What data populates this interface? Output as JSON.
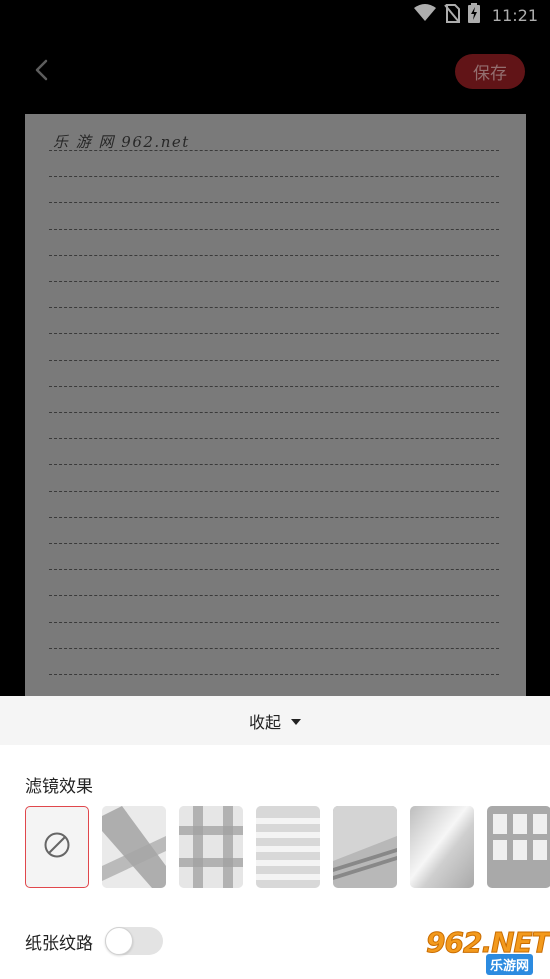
{
  "status_bar": {
    "time": "11:21",
    "icons": [
      "wifi-icon",
      "no-sim-icon",
      "battery-charging-icon"
    ]
  },
  "top_bar": {
    "back_icon": "chevron-left-icon",
    "save_label": "保存",
    "save_color": "#8f1e22"
  },
  "preview": {
    "handwriting": "乐 游 网 962.net"
  },
  "sheet": {
    "collapse_label": "收起",
    "filters_title": "滤镜效果",
    "filters": [
      {
        "name": "none",
        "icon": "ban-icon",
        "selected": true
      },
      {
        "name": "shadow-cross",
        "selected": false
      },
      {
        "name": "shadow-window",
        "selected": false
      },
      {
        "name": "shadow-blinds",
        "selected": false
      },
      {
        "name": "shadow-diagonal",
        "selected": false
      },
      {
        "name": "gradient-light",
        "selected": false
      },
      {
        "name": "shadow-grid",
        "selected": false
      }
    ],
    "paper_texture_label": "纸张纹路",
    "paper_texture_on": false
  },
  "watermark": {
    "main": "962.NET",
    "sub": "乐游网"
  },
  "colors": {
    "accent": "#e0474c",
    "background": "#000000"
  }
}
